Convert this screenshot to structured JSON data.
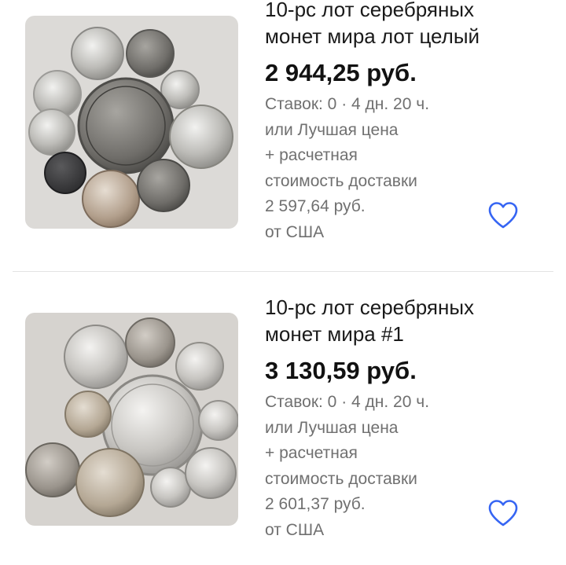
{
  "listings": [
    {
      "title_line1": "10-рс лот серебряных",
      "title_line2": "монет мира лот целый",
      "price": "2 944,25 руб.",
      "bids_time": "Ставок: 0 · 4 дн. 20 ч.",
      "best_offer": "или Лучшая цена",
      "shipping_line1": "+ расчетная",
      "shipping_line2": "стоимость доставки",
      "shipping_cost": "2 597,64 руб.",
      "origin": "от США",
      "watch_icon": "heart-outline"
    },
    {
      "title_line1": "10-рс лот серебряных",
      "title_line2": "монет мира #1",
      "price": "3 130,59 руб.",
      "bids_time": "Ставок: 0 · 4 дн. 20 ч.",
      "best_offer": "или Лучшая цена",
      "shipping_line1": "+ расчетная",
      "shipping_line2": "стоимость доставки",
      "shipping_cost": "2 601,37 руб.",
      "origin": "от США",
      "watch_icon": "heart-outline"
    }
  ],
  "colors": {
    "accent": "#3665f3",
    "secondary_text": "#707070",
    "divider": "#e3e3e3"
  }
}
